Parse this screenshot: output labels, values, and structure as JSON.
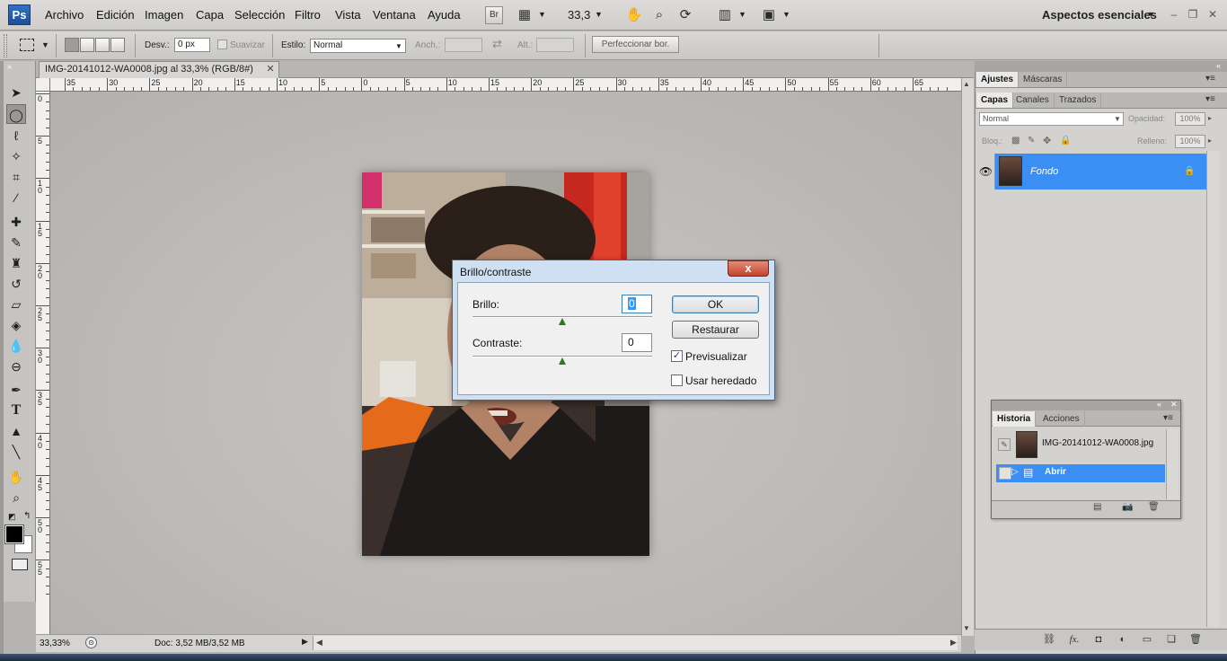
{
  "app": {
    "logo": "Ps",
    "workspace": "Aspectos esenciales"
  },
  "menu": [
    "Archivo",
    "Edición",
    "Imagen",
    "Capa",
    "Selección",
    "Filtro",
    "Vista",
    "Ventana",
    "Ayuda"
  ],
  "appbar": {
    "bridge_label": "Br",
    "zoom": "33,3"
  },
  "options": {
    "feather_label": "Desv.:",
    "feather_value": "0 px",
    "antialias_label": "Suavizar",
    "style_label": "Estilo:",
    "style_value": "Normal",
    "width_label": "Anch.:",
    "height_label": "Alt.:",
    "refine_button": "Perfeccionar bor."
  },
  "document": {
    "tab_title": "IMG-20141012-WA0008.jpg al 33,3% (RGB/8#)",
    "zoom_status": "33,33%",
    "doc_size": "Doc: 3,52 MB/3,52 MB"
  },
  "rulers": {
    "horizontal": [
      "35",
      "30",
      "25",
      "20",
      "15",
      "10",
      "5",
      "0",
      "5",
      "10",
      "15",
      "20",
      "25",
      "30",
      "35",
      "40",
      "45",
      "50",
      "55",
      "60",
      "65"
    ],
    "vertical": [
      "0",
      "5",
      "1 0",
      "1 5",
      "2 0",
      "2 5",
      "3 0",
      "3 5",
      "4 0",
      "4 5",
      "5 0",
      "5 5"
    ]
  },
  "panels": {
    "top_tabs": [
      "Ajustes",
      "Máscaras"
    ],
    "layer_tabs": [
      "Capas",
      "Canales",
      "Trazados"
    ],
    "blend_mode": "Normal",
    "opacity_label": "Opacidad:",
    "opacity_value": "100%",
    "lock_label": "Bloq.:",
    "fill_label": "Relleno:",
    "fill_value": "100%",
    "layer_name": "Fondo"
  },
  "history": {
    "tabs": [
      "Historia",
      "Acciones"
    ],
    "snapshot": "IMG-20141012-WA0008.jpg",
    "step": "Abrir"
  },
  "dialog": {
    "title": "Brillo/contraste",
    "close": "x",
    "brightness_label": "Brillo:",
    "brightness_value": "0",
    "contrast_label": "Contraste:",
    "contrast_value": "0",
    "ok_button": "OK",
    "reset_button": "Restaurar",
    "preview_label": "Previsualizar",
    "preview_checked": true,
    "legacy_label": "Usar heredado",
    "legacy_checked": false,
    "brightness_level": 0,
    "contrast_level": 0
  },
  "colors": {
    "selection_blue": "#3a8ef4",
    "dialog_frame": "#cfe0f2"
  }
}
